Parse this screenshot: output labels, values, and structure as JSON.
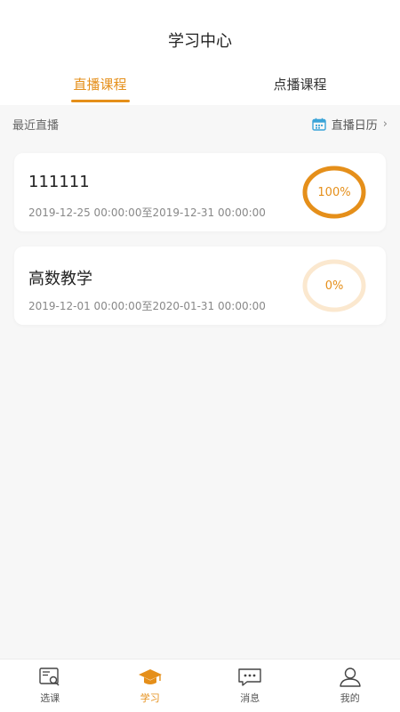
{
  "header": {
    "title": "学习中心"
  },
  "tabs": [
    {
      "label": "直播课程",
      "active": true
    },
    {
      "label": "点播课程",
      "active": false
    }
  ],
  "section": {
    "label": "最近直播",
    "calendar_label": "直播日历",
    "calendar_icon": "calendar-icon",
    "chevron": "›"
  },
  "courses": [
    {
      "title": "111111",
      "time": "2019-12-25 00:00:00至2019-12-31 00:00:00",
      "progress_label": "100%",
      "progress": 1.0
    },
    {
      "title": "高数教学",
      "time": "2019-12-01 00:00:00至2020-01-31 00:00:00",
      "progress_label": "0%",
      "progress": 0.0
    }
  ],
  "tabbar": [
    {
      "label": "选课",
      "icon": "course-select-icon",
      "active": false
    },
    {
      "label": "学习",
      "icon": "graduation-cap-icon",
      "active": true
    },
    {
      "label": "消息",
      "icon": "message-icon",
      "active": false
    },
    {
      "label": "我的",
      "icon": "user-icon",
      "active": false
    }
  ],
  "colors": {
    "accent": "#e58f1a",
    "accent_light": "#fbe8cf",
    "background": "#f7f7f7"
  }
}
